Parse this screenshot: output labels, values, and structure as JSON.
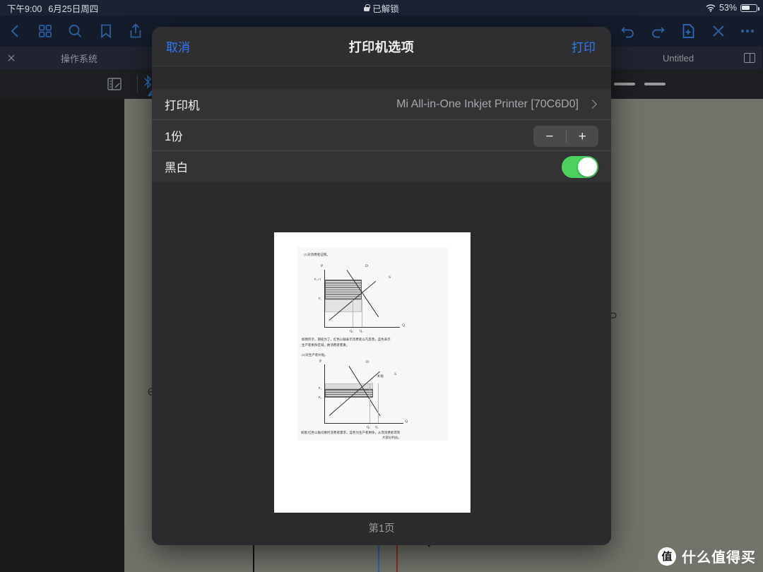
{
  "status_bar": {
    "time": "下午9:00",
    "date": "6月25日周四",
    "lock_status": "已解锁",
    "battery_percent": "53%",
    "icons": {
      "lock": "lock-icon",
      "wifi": "wifi-icon",
      "battery": "battery-icon"
    }
  },
  "app_toolbar": {
    "left_icons": [
      {
        "name": "back-icon",
        "label": "返回"
      },
      {
        "name": "grid-icon",
        "label": "缩略图"
      },
      {
        "name": "search-icon",
        "label": "搜索"
      },
      {
        "name": "bookmark-icon",
        "label": "书签"
      },
      {
        "name": "share-icon",
        "label": "共享"
      }
    ],
    "right_icons": [
      {
        "name": "undo-icon",
        "label": "撤销"
      },
      {
        "name": "redo-icon",
        "label": "重做"
      },
      {
        "name": "new-page-icon",
        "label": "新建页面"
      },
      {
        "name": "close-icon",
        "label": "关闭"
      },
      {
        "name": "more-icon",
        "label": "更多"
      }
    ]
  },
  "tabs": [
    {
      "name": "tab-os",
      "label": "操作系统"
    },
    {
      "name": "tab-untitled",
      "label": "Untitled"
    }
  ],
  "sub_toolbar": {
    "icons": [
      {
        "name": "page-layout-icon"
      },
      {
        "name": "bluetooth-icon"
      },
      {
        "name": "pen-icon"
      }
    ]
  },
  "modal": {
    "title": "打印机选项",
    "cancel_label": "取消",
    "print_label": "打印",
    "rows": [
      {
        "name": "printer-row",
        "label": "打印机",
        "value": "Mi All-in-One Inkjet Printer [70C6D0]",
        "control": "chevron"
      },
      {
        "name": "copies-row",
        "label": "1份",
        "value": "",
        "control": "stepper",
        "stepper": {
          "minus": "−",
          "plus": "+"
        }
      },
      {
        "name": "blackwhite-row",
        "label": "黑白",
        "value": "",
        "control": "toggle",
        "toggle": {
          "state": "on",
          "color": "#4cd05f"
        }
      }
    ],
    "preview": {
      "page_caption": "第1页",
      "document": {
        "heading_1": "(1)对消费者征税。",
        "heading_2": "(2)对生产者补贴。",
        "note_1": "如图所示，期初为了，红色以轴表示消费者以凡反馈，蓝色表示",
        "note_1b": "生产者剩余区域，故消费者需重。",
        "note_2": "如图 红色以轴均衡时消费者需求，蓝色为生产者剩余，从而消费者得到",
        "note_2b": "大部分利益。",
        "axis_labels_1": {
          "y": "P",
          "x": "Q",
          "demand": "D",
          "supply": "S",
          "p1": "P₁+T",
          "p0": "P₁",
          "q0": "Q₀",
          "q1": "Q₁"
        },
        "axis_labels_2": {
          "y": "P",
          "x": "Q",
          "demand": "D",
          "supply": "S",
          "p1": "P₁",
          "p0": "P₀",
          "q0": "Q₀",
          "q1": "Q₁"
        },
        "annotation": "补贴"
      }
    }
  },
  "watermark": {
    "badge": "值",
    "text": "什么值得买"
  },
  "colors": {
    "accent_blue": "#2f7bf6",
    "toggle_green": "#4cd05f",
    "modal_bg": "#2b2b2d",
    "row_bg": "#333335",
    "status_bar_bg": "#1a2233",
    "page_gray": "#6f7369"
  }
}
